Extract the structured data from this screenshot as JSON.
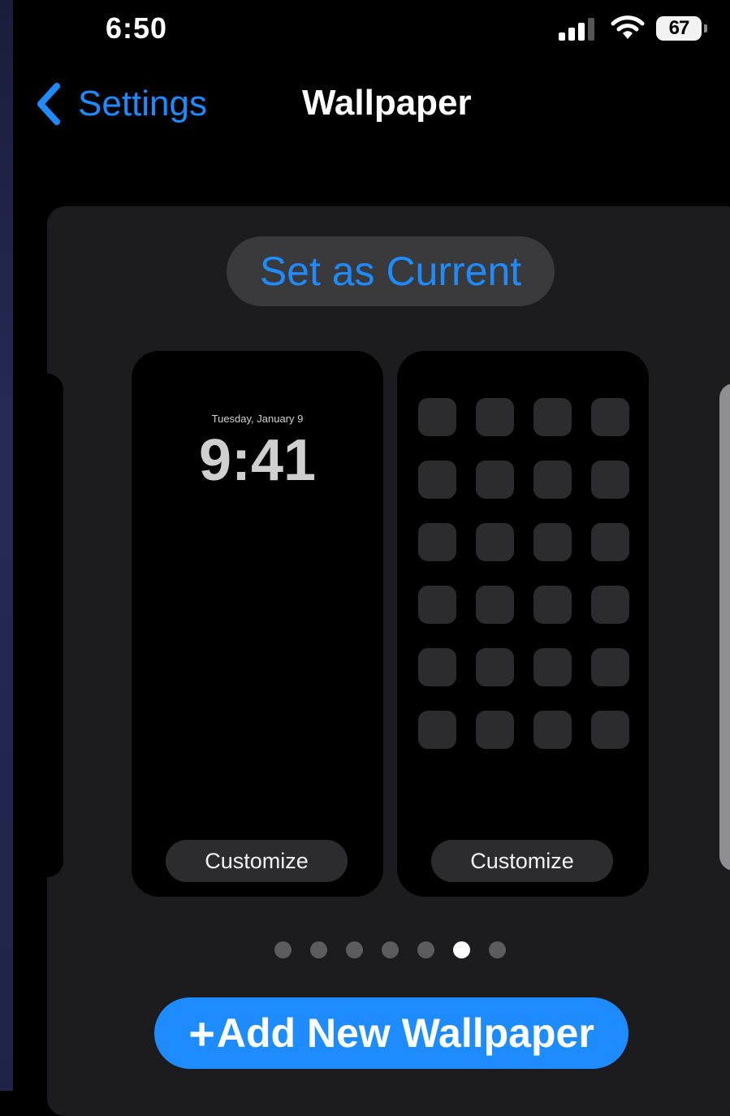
{
  "status_bar": {
    "time": "6:50",
    "battery_level": "67",
    "icons": [
      "cellular-signal-icon",
      "wifi-icon",
      "battery-icon"
    ]
  },
  "nav": {
    "back_label": "Settings",
    "title": "Wallpaper",
    "back_icon": "chevron-left-icon"
  },
  "wallpaper_card": {
    "set_current_label": "Set as Current",
    "lock_preview": {
      "date": "Tuesday, January 9",
      "time": "9:41",
      "customize_label": "Customize"
    },
    "home_preview": {
      "app_icon_rows": 6,
      "app_icon_columns": 4,
      "customize_label": "Customize"
    },
    "page_indicator": {
      "total_pages": 7,
      "current_page": 6
    }
  },
  "add_button": {
    "plus": "+",
    "label": "Add New Wallpaper"
  },
  "colors": {
    "accent": "#1e8cff",
    "background": "#000000",
    "card": "#1c1c1e",
    "button_fill": "#3a3a3c"
  }
}
